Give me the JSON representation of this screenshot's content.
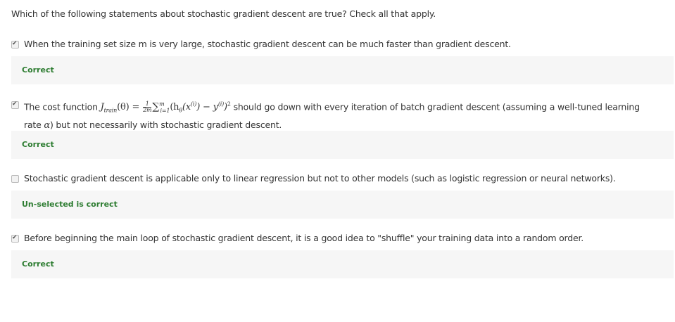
{
  "question": "Which of the following statements about stochastic gradient descent are true? Check all that apply.",
  "options": [
    {
      "checked": true,
      "text": "When the training set size m is very large, stochastic gradient descent can be much faster than gradient descent.",
      "feedback": "Correct"
    },
    {
      "checked": true,
      "text_prefix": "The cost function",
      "math": {
        "J": "J",
        "J_sub": "train",
        "theta_arg": "(θ)",
        "equals": "=",
        "frac_num": "1",
        "frac_den": "2m",
        "sum": "∑",
        "sum_sup": "m",
        "sum_sub": "i=1",
        "body_open": "(h",
        "h_sub": "θ",
        "x_open": "(x",
        "x_sup": "(i)",
        "x_close": ")",
        "minus": "−",
        "y": "y",
        "y_sup": "(i)",
        "body_close": ")",
        "sq": "2"
      },
      "text_suffix_1": "should go down with every iteration of batch gradient descent (assuming a well-tuned learning",
      "text_suffix_2_a": "rate",
      "alpha": "α",
      "text_suffix_2_b": ") but not necessarily with stochastic gradient descent.",
      "feedback": "Correct"
    },
    {
      "checked": false,
      "text": "Stochastic gradient descent is applicable only to linear regression but not to other models (such as logistic regression or neural networks).",
      "feedback": "Un-selected is correct"
    },
    {
      "checked": true,
      "text": "Before beginning the main loop of stochastic gradient descent, it is a good idea to \"shuffle\" your training data into a random order.",
      "feedback": "Correct"
    }
  ],
  "colors": {
    "feedback_green": "#2e7d32",
    "feedback_bg": "#f6f6f6"
  },
  "check_glyph": "✔"
}
